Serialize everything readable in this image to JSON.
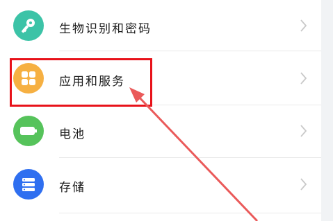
{
  "settings": {
    "items": [
      {
        "label": "生物识别和密码",
        "icon": "key-icon",
        "color": "#3cc3a7"
      },
      {
        "label": "应用和服务",
        "icon": "apps-grid-icon",
        "color": "#f6b042"
      },
      {
        "label": "电池",
        "icon": "battery-icon",
        "color": "#56c35b"
      },
      {
        "label": "存储",
        "icon": "storage-icon",
        "color": "#2f6ff0"
      }
    ]
  },
  "annotation": {
    "highlight_color": "#e8121a",
    "arrow_color": "#ea5a5a"
  }
}
